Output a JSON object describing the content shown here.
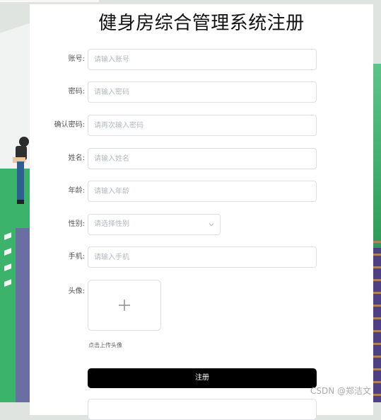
{
  "title": "健身房综合管理系统注册",
  "fields": {
    "account": {
      "label": "账号:",
      "placeholder": "请输入账号"
    },
    "password": {
      "label": "密码:",
      "placeholder": "请输入密码"
    },
    "confirm": {
      "label": "确认密码:",
      "placeholder": "请再次输入密码"
    },
    "name": {
      "label": "姓名:",
      "placeholder": "请输入姓名"
    },
    "age": {
      "label": "年龄:",
      "placeholder": "请输入年龄"
    },
    "gender": {
      "label": "性别:",
      "placeholder": "请选择性别"
    },
    "phone": {
      "label": "手机:",
      "placeholder": "请输入手机"
    },
    "avatar": {
      "label": "头像:",
      "hint": "点击上传头像"
    }
  },
  "submit_label": "注册",
  "watermark": "CSDN @郑洁文",
  "colors": {
    "submit_bg": "#000000",
    "border": "#dcdfe6",
    "placeholder": "#b4b8bf"
  },
  "icons": {
    "select": "chevron-down-icon",
    "upload": "plus-icon"
  }
}
